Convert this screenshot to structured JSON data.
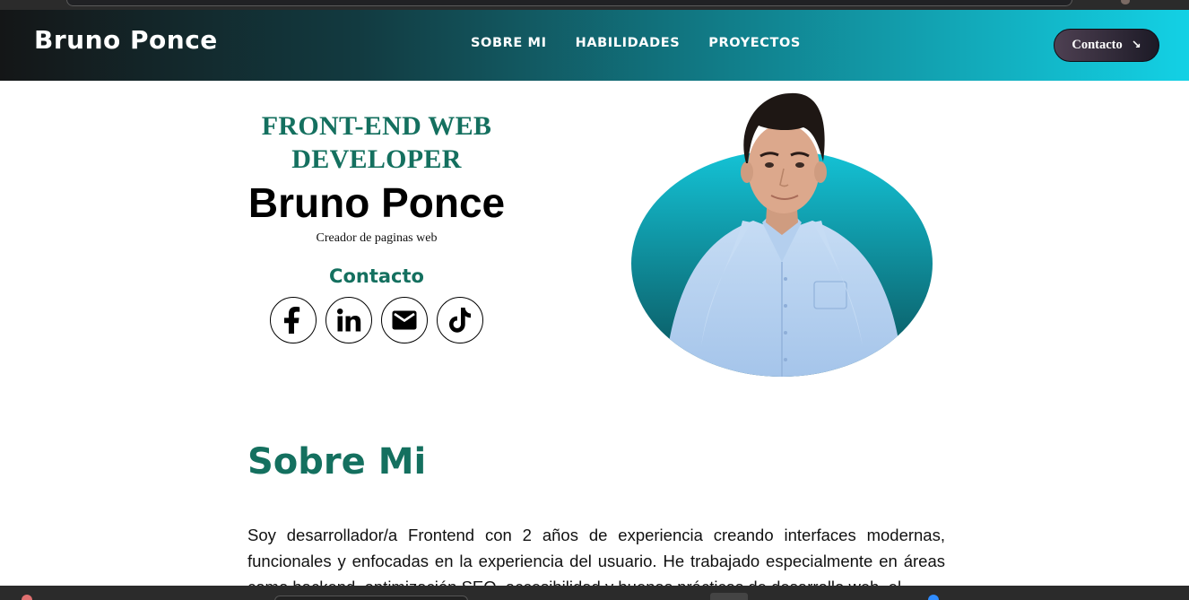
{
  "navbar": {
    "brand": "Bruno Ponce",
    "links": [
      "SOBRE MI",
      "HABILIDADES",
      "PROYECTOS"
    ],
    "contact_button": "Contacto",
    "contact_button_icon": "arrow-down-right-icon"
  },
  "hero": {
    "role": "FRONT-END WEB DEVELOPER",
    "name": "Bruno Ponce",
    "subtitle": "Creador de paginas web",
    "contact_heading": "Contacto",
    "social_icons": [
      "facebook-icon",
      "linkedin-icon",
      "email-icon",
      "tiktok-icon"
    ]
  },
  "about": {
    "title": "Sobre Mi",
    "text": "Soy desarrollador/a Frontend con 2 años de experiencia creando interfaces modernas, funcionales y enfocadas en la experiencia del usuario. He trabajado especialmente en áreas como backend, optimización SEO, accesibilidad y buenas prácticas de desarrollo web, el"
  },
  "colors": {
    "accent": "#14705f",
    "nav_gradient_start": "#141617",
    "nav_gradient_end": "#13d1e5",
    "portrait_circle_top": "#14c3d6",
    "portrait_circle_bottom": "#0a5058"
  }
}
